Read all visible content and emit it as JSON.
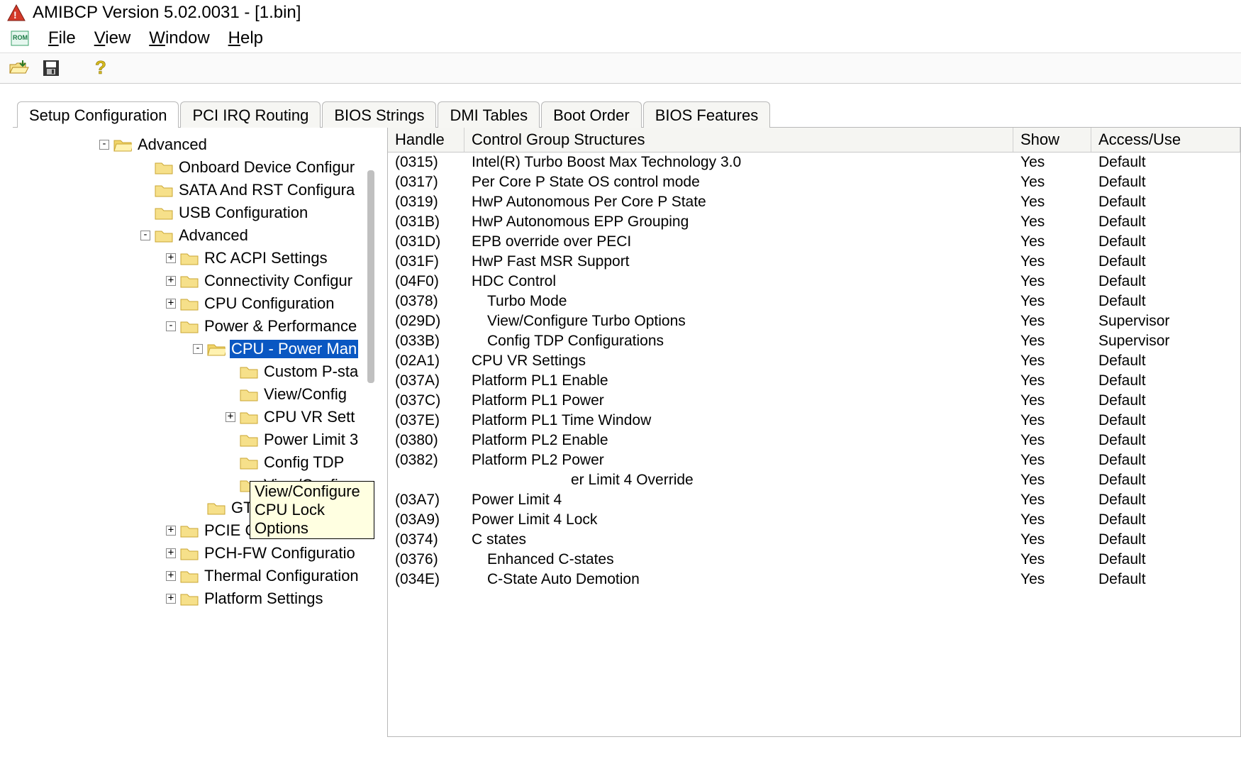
{
  "window": {
    "title": "AMIBCP Version 5.02.0031 - [1.bin]"
  },
  "menu": {
    "file": "File",
    "view": "View",
    "window": "Window",
    "help": "Help"
  },
  "tabs": [
    {
      "label": "Setup Configuration",
      "active": true
    },
    {
      "label": "PCI IRQ Routing"
    },
    {
      "label": "BIOS Strings"
    },
    {
      "label": "DMI Tables"
    },
    {
      "label": "Boot Order"
    },
    {
      "label": "BIOS Features"
    }
  ],
  "tree": {
    "root": "Advanced",
    "items": [
      {
        "depth": 1,
        "exp": "",
        "label": "Onboard Device Configur"
      },
      {
        "depth": 1,
        "exp": "",
        "label": "SATA And RST Configura"
      },
      {
        "depth": 1,
        "exp": "",
        "label": "USB Configuration"
      },
      {
        "depth": 1,
        "exp": "-",
        "label": "Advanced"
      },
      {
        "depth": 2,
        "exp": "+",
        "label": "RC ACPI Settings"
      },
      {
        "depth": 2,
        "exp": "+",
        "label": "Connectivity Configur"
      },
      {
        "depth": 2,
        "exp": "+",
        "label": "CPU Configuration"
      },
      {
        "depth": 2,
        "exp": "-",
        "label": "Power & Performance"
      },
      {
        "depth": 3,
        "exp": "-",
        "label": "CPU - Power Man",
        "selected": true,
        "open": true
      },
      {
        "depth": 4,
        "exp": "",
        "label": "Custom P-sta"
      },
      {
        "depth": 4,
        "exp": "",
        "label": "View/Config"
      },
      {
        "depth": 4,
        "exp": "+",
        "label": "CPU VR Sett"
      },
      {
        "depth": 4,
        "exp": "",
        "label": "Power Limit 3"
      },
      {
        "depth": 4,
        "exp": "",
        "label": "Config TDP"
      },
      {
        "depth": 4,
        "exp": "",
        "label": "View/Configu"
      },
      {
        "depth": 3,
        "exp": "",
        "label": "GT - Power Mana"
      },
      {
        "depth": 2,
        "exp": "+",
        "label": "PCIE Configuration"
      },
      {
        "depth": 2,
        "exp": "+",
        "label": "PCH-FW Configuratio"
      },
      {
        "depth": 2,
        "exp": "+",
        "label": "Thermal Configuration"
      },
      {
        "depth": 2,
        "exp": "+",
        "label": "Platform Settings"
      }
    ]
  },
  "tooltip": "View/Configure CPU Lock Options",
  "table": {
    "headers": [
      "Handle",
      "Control Group Structures",
      "Show",
      "Access/Use"
    ],
    "rows": [
      {
        "h": "(0315)",
        "n": "Intel(R) Turbo Boost Max Technology 3.0",
        "s": "Yes",
        "a": "Default",
        "lvl": 0
      },
      {
        "h": "(0317)",
        "n": "Per Core P State OS control mode",
        "s": "Yes",
        "a": "Default",
        "lvl": 0
      },
      {
        "h": "(0319)",
        "n": "HwP Autonomous Per Core P State",
        "s": "Yes",
        "a": "Default",
        "lvl": 0
      },
      {
        "h": "(031B)",
        "n": "HwP Autonomous EPP Grouping",
        "s": "Yes",
        "a": "Default",
        "lvl": 0
      },
      {
        "h": "(031D)",
        "n": "EPB override over PECI",
        "s": "Yes",
        "a": "Default",
        "lvl": 0
      },
      {
        "h": "(031F)",
        "n": "HwP Fast MSR Support",
        "s": "Yes",
        "a": "Default",
        "lvl": 0
      },
      {
        "h": "(04F0)",
        "n": "HDC Control",
        "s": "Yes",
        "a": "Default",
        "lvl": 0
      },
      {
        "h": "(0378)",
        "n": "Turbo Mode",
        "s": "Yes",
        "a": "Default",
        "lvl": 1
      },
      {
        "h": "(029D)",
        "n": "View/Configure Turbo Options",
        "s": "Yes",
        "a": "Supervisor",
        "lvl": 1
      },
      {
        "h": "(033B)",
        "n": "Config TDP Configurations",
        "s": "Yes",
        "a": "Supervisor",
        "lvl": 1
      },
      {
        "h": "(02A1)",
        "n": "CPU VR Settings",
        "s": "Yes",
        "a": "Default",
        "lvl": 0
      },
      {
        "h": "(037A)",
        "n": "Platform PL1 Enable",
        "s": "Yes",
        "a": "Default",
        "lvl": 0
      },
      {
        "h": "(037C)",
        "n": "Platform PL1 Power",
        "s": "Yes",
        "a": "Default",
        "lvl": 0
      },
      {
        "h": "(037E)",
        "n": "Platform PL1 Time Window",
        "s": "Yes",
        "a": "Default",
        "lvl": 0
      },
      {
        "h": "(0380)",
        "n": "Platform PL2 Enable",
        "s": "Yes",
        "a": "Default",
        "lvl": 0
      },
      {
        "h": "(0382)",
        "n": "Platform PL2 Power",
        "s": "Yes",
        "a": "Default",
        "lvl": 0
      },
      {
        "h": "",
        "n": "er Limit 4 Override",
        "s": "Yes",
        "a": "Default",
        "lvl": 0,
        "clip": true
      },
      {
        "h": "(03A7)",
        "n": "Power Limit 4",
        "s": "Yes",
        "a": "Default",
        "lvl": 0
      },
      {
        "h": "(03A9)",
        "n": "Power Limit 4 Lock",
        "s": "Yes",
        "a": "Default",
        "lvl": 0
      },
      {
        "h": "(0374)",
        "n": "C states",
        "s": "Yes",
        "a": "Default",
        "lvl": 0
      },
      {
        "h": "(0376)",
        "n": "Enhanced C-states",
        "s": "Yes",
        "a": "Default",
        "lvl": 1
      },
      {
        "h": "(034E)",
        "n": "C-State Auto Demotion",
        "s": "Yes",
        "a": "Default",
        "lvl": 1
      }
    ]
  }
}
